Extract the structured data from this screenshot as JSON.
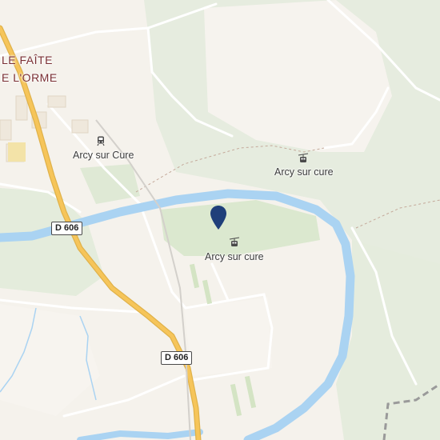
{
  "places": {
    "town_line1": "LE FAÎTE",
    "town_line2": "E L'ORME",
    "station": "Arcy sur Cure",
    "aerial_top": "Arcy sur cure",
    "aerial_main": "Arcy sur cure"
  },
  "roads": {
    "d606_west": "D 606",
    "d606_south": "D 606"
  },
  "icons": {
    "station": "train-station-icon",
    "aerial_top": "cable-car-icon",
    "aerial_main": "cable-car-icon",
    "pin": "location-pin-icon"
  },
  "colors": {
    "background": "#f5f2ec",
    "vegetation": "#e3ebdc",
    "river": "#aad3f2",
    "highway": "#f6c55a",
    "pin": "#1f3f7a",
    "town_label": "#7a2f33"
  }
}
